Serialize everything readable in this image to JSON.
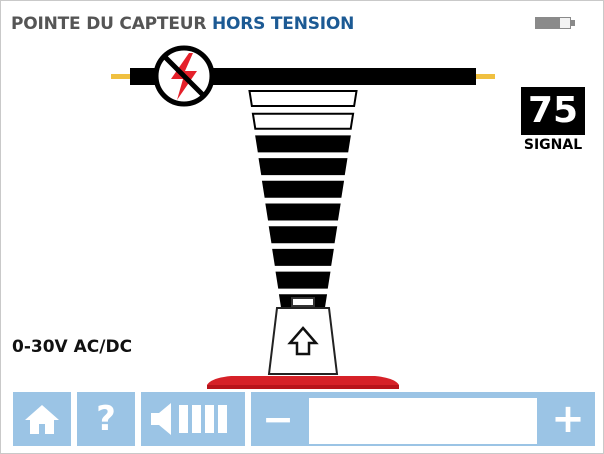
{
  "header": {
    "title_part1": "POINTE DU CAPTEUR",
    "title_part2": "HORS TENSION",
    "battery_icon": "battery-icon"
  },
  "signal": {
    "value": "75",
    "label": "SIGNAL"
  },
  "range_label": "0-30V AC/DC",
  "gauge": {
    "no_voltage_icon": "no-voltage-icon",
    "probe_icon": "probe-up-arrow-icon",
    "bars_total": 10,
    "bars_filled": 8
  },
  "toolbar": {
    "home_icon": "home-icon",
    "help_label": "?",
    "volume_icon": "speaker-volume-icon",
    "minus_label": "−",
    "plus_label": "+",
    "volume_level": 0
  },
  "colors": {
    "title_gray": "#555555",
    "title_blue": "#1c5a94",
    "toolbar_blue": "#9bc4e5",
    "lightning_red": "#e5202a",
    "base_red": "#d62128",
    "wire_tip": "#f0c040"
  }
}
